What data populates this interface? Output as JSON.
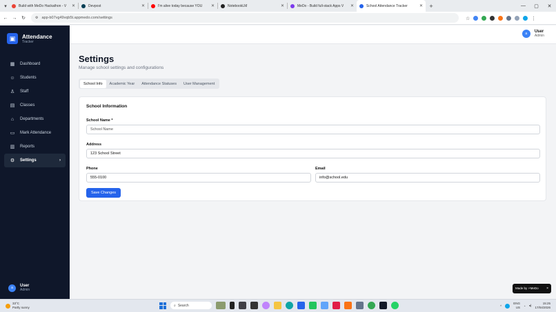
{
  "browser": {
    "tabs": [
      {
        "label": "Build with MeDo Hackathon - V",
        "color": "#ea4335"
      },
      {
        "label": "Devpost",
        "color": "#003e54"
      },
      {
        "label": "I'm alive today because YOU",
        "color": "#ff0000"
      },
      {
        "label": "NotebookLM",
        "color": "#222222"
      },
      {
        "label": "MeDo - Build full-stack Apps V",
        "color": "#7c3aed"
      },
      {
        "label": "School Attendance Tracker",
        "color": "#2563eb"
      }
    ],
    "url": "app-b07vg49vqb5t.appmedo.com/settings"
  },
  "sidebar": {
    "brand_name": "Attendance",
    "brand_sub": "Tracker",
    "items": [
      {
        "label": "Dashboard",
        "icon": "grid-icon"
      },
      {
        "label": "Students",
        "icon": "users-icon"
      },
      {
        "label": "Staff",
        "icon": "user-icon"
      },
      {
        "label": "Classes",
        "icon": "book-icon"
      },
      {
        "label": "Departments",
        "icon": "building-icon"
      },
      {
        "label": "Mark Attendance",
        "icon": "clipboard-icon"
      },
      {
        "label": "Reports",
        "icon": "chart-icon"
      },
      {
        "label": "Settings",
        "icon": "gear-icon"
      }
    ],
    "user_name": "User",
    "user_role": "Admin",
    "avatar_letter": "a"
  },
  "topbar": {
    "user_name": "User",
    "user_role": "Admin",
    "avatar_letter": "a"
  },
  "page": {
    "title": "Settings",
    "subtitle": "Manage school settings and configurations",
    "tabs": [
      "School Info",
      "Academic Year",
      "Attendance Statuses",
      "User Management"
    ]
  },
  "form": {
    "title": "School Information",
    "school_name_label": "School Name *",
    "school_name_placeholder": "School Name",
    "address_label": "Address",
    "address_value": "123 School Street",
    "phone_label": "Phone",
    "phone_value": "555-0100",
    "email_label": "Email",
    "email_value": "info@school.edu",
    "save_label": "Save Changes"
  },
  "badge": {
    "made_by": "Made by ⚡MeDo",
    "close": "×"
  },
  "taskbar": {
    "temp": "33°C",
    "weather": "Partly sunny",
    "search_placeholder": "Search",
    "lang1": "ENG",
    "lang2": "US",
    "time": "15:25",
    "date": "17/04/2026"
  }
}
